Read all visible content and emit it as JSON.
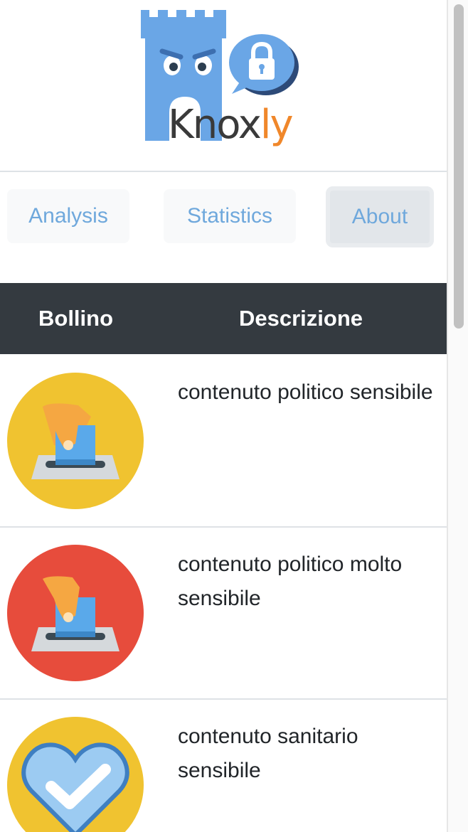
{
  "logo": {
    "wordmark_main": "Knox",
    "wordmark_accent": "ly",
    "colors": {
      "tower": "#6aa6e6",
      "accent": "#f0872a",
      "text": "#3a3a3a"
    }
  },
  "nav": {
    "items": [
      {
        "label": "Analysis"
      },
      {
        "label": "Statistics"
      },
      {
        "label": "About",
        "active": true
      }
    ],
    "link_color": "#6fa8dc"
  },
  "table": {
    "headers": [
      "Bollino",
      "Descrizione"
    ],
    "header_bg": "#343a40",
    "rows": [
      {
        "badge_icon": "ballot-box-icon",
        "badge_color": "#f0c330",
        "description": "contenuto politico sensibile"
      },
      {
        "badge_icon": "ballot-box-icon",
        "badge_color": "#e74c3c",
        "description": "contenuto politico molto sensibile"
      },
      {
        "badge_icon": "heart-check-icon",
        "badge_color": "#f0c330",
        "description": "contenuto sanitario sensibile"
      }
    ]
  }
}
